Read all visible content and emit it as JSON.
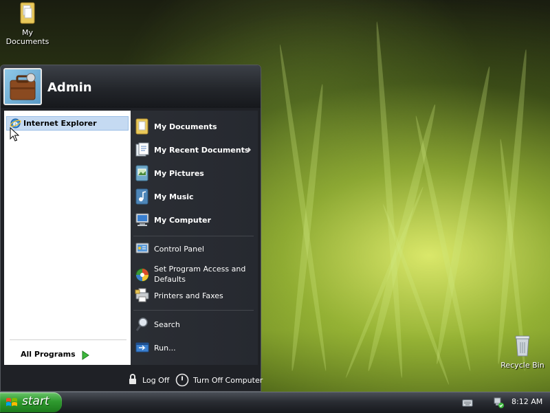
{
  "desktop": {
    "icons": [
      {
        "label": "My Documents",
        "icon": "folder-documents-icon"
      },
      {
        "label": "Recycle Bin",
        "icon": "recycle-bin-icon"
      }
    ]
  },
  "start_menu": {
    "user_name": "Admin",
    "pinned": [
      {
        "label": "Internet Explorer",
        "icon": "internet-explorer-icon",
        "highlighted": true
      }
    ],
    "all_programs_label": "All Programs",
    "places": [
      {
        "label": "My Documents",
        "icon": "my-documents-icon"
      },
      {
        "label": "My Recent Documents",
        "icon": "recent-documents-icon",
        "has_submenu": true
      },
      {
        "label": "My Pictures",
        "icon": "my-pictures-icon"
      },
      {
        "label": "My Music",
        "icon": "my-music-icon"
      },
      {
        "label": "My Computer",
        "icon": "my-computer-icon"
      }
    ],
    "system": [
      {
        "label": "Control Panel",
        "icon": "control-panel-icon"
      },
      {
        "label": "Set Program Access and Defaults",
        "icon": "program-access-icon"
      },
      {
        "label": "Printers and Faxes",
        "icon": "printers-icon"
      }
    ],
    "tools": [
      {
        "label": "Search",
        "icon": "search-icon"
      },
      {
        "label": "Run...",
        "icon": "run-icon"
      }
    ],
    "footer": {
      "log_off_label": "Log Off",
      "turn_off_label": "Turn Off Computer"
    }
  },
  "taskbar": {
    "start_label": "start",
    "clock": "8:12 AM",
    "tray_icons": [
      "keyboard-icon",
      "network-icon"
    ]
  },
  "colors": {
    "taskbar_dark": "#17191d",
    "start_green": "#2f9a2f",
    "highlight": "#c5daf2",
    "menu_dark": "#262930"
  }
}
